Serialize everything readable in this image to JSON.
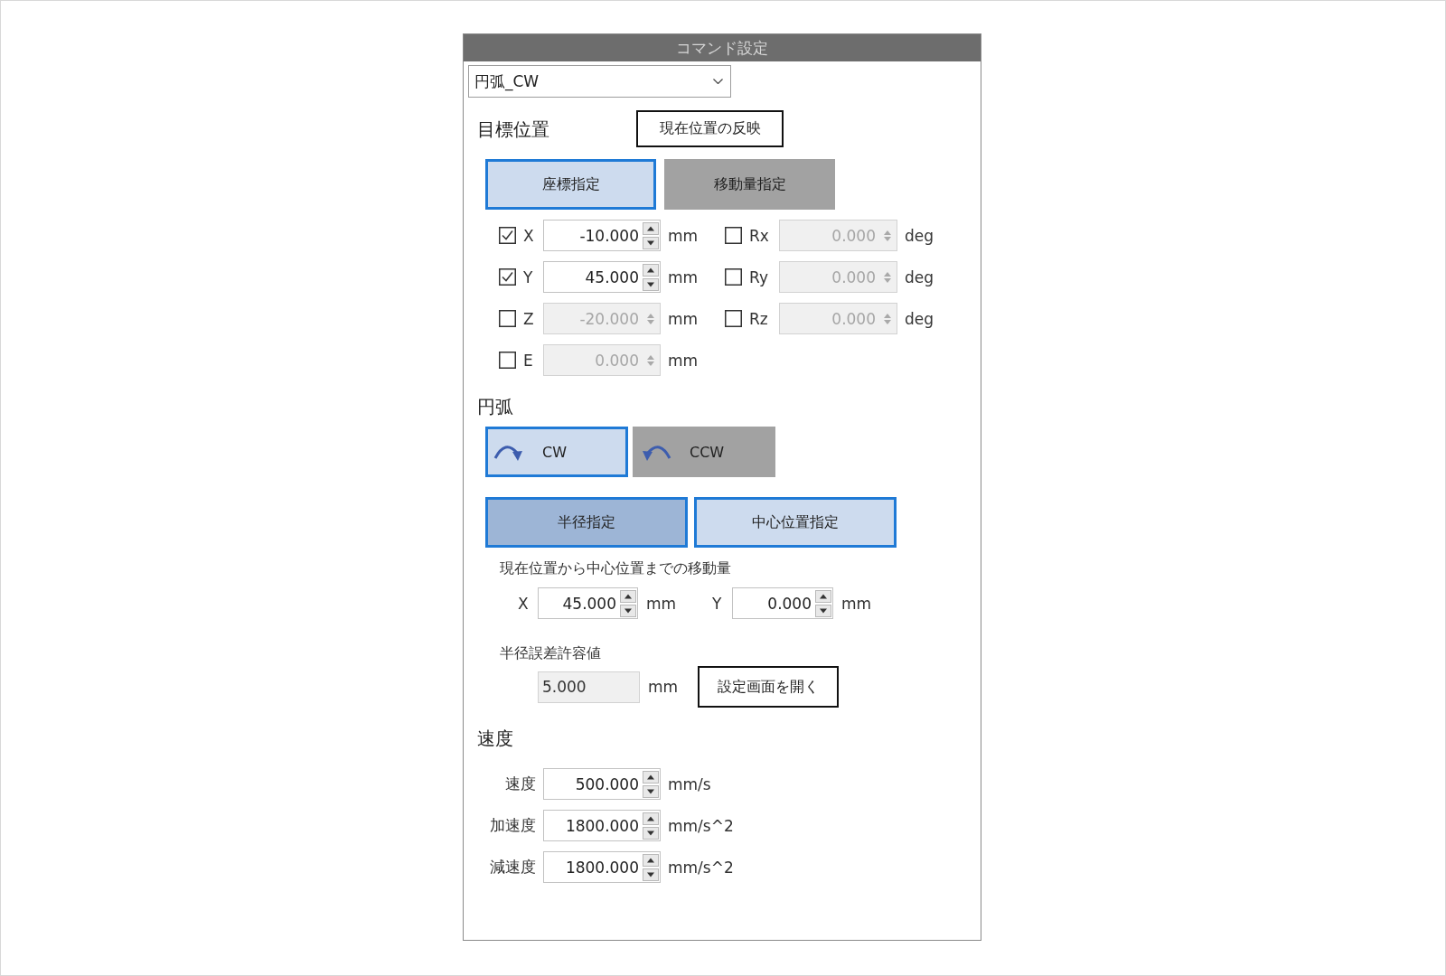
{
  "window": {
    "title": "コマンド設定"
  },
  "command_select": {
    "value": "円弧_CW"
  },
  "target_position": {
    "label": "目標位置",
    "reflect_button": "現在位置の反映",
    "modes": [
      {
        "label": "座標指定",
        "selected": true
      },
      {
        "label": "移動量指定",
        "selected": false
      }
    ],
    "axes": [
      {
        "name": "X",
        "checked": true,
        "value": "-10.000",
        "unit": "mm"
      },
      {
        "name": "Y",
        "checked": true,
        "value": "45.000",
        "unit": "mm"
      },
      {
        "name": "Z",
        "checked": false,
        "value": "-20.000",
        "unit": "mm"
      },
      {
        "name": "E",
        "checked": false,
        "value": "0.000",
        "unit": "mm"
      }
    ],
    "rotations": [
      {
        "name": "Rx",
        "checked": false,
        "value": "0.000",
        "unit": "deg"
      },
      {
        "name": "Ry",
        "checked": false,
        "value": "0.000",
        "unit": "deg"
      },
      {
        "name": "Rz",
        "checked": false,
        "value": "0.000",
        "unit": "deg"
      }
    ]
  },
  "arc": {
    "label": "円弧",
    "directions": [
      {
        "kind": "cw",
        "label": "CW",
        "selected": true
      },
      {
        "kind": "ccw",
        "label": "CCW",
        "selected": false
      }
    ],
    "methods": [
      {
        "label": "半径指定",
        "selected": false,
        "hovered": true
      },
      {
        "label": "中心位置指定",
        "selected": true,
        "hovered": false
      }
    ],
    "center_offset": {
      "label": "現在位置から中心位置までの移動量",
      "fields": [
        {
          "name": "X",
          "value": "45.000",
          "unit": "mm"
        },
        {
          "name": "Y",
          "value": "0.000",
          "unit": "mm"
        }
      ]
    },
    "radius_tolerance": {
      "label": "半径誤差許容値",
      "value": "5.000",
      "unit": "mm",
      "readonly": true,
      "settings_button": "設定画面を開く"
    }
  },
  "speed": {
    "label": "速度",
    "rows": [
      {
        "label": "速度",
        "value": "500.000",
        "unit": "mm/s"
      },
      {
        "label": "加速度",
        "value": "1800.000",
        "unit": "mm/s^2"
      },
      {
        "label": "減速度",
        "value": "1800.000",
        "unit": "mm/s^2"
      }
    ]
  }
}
